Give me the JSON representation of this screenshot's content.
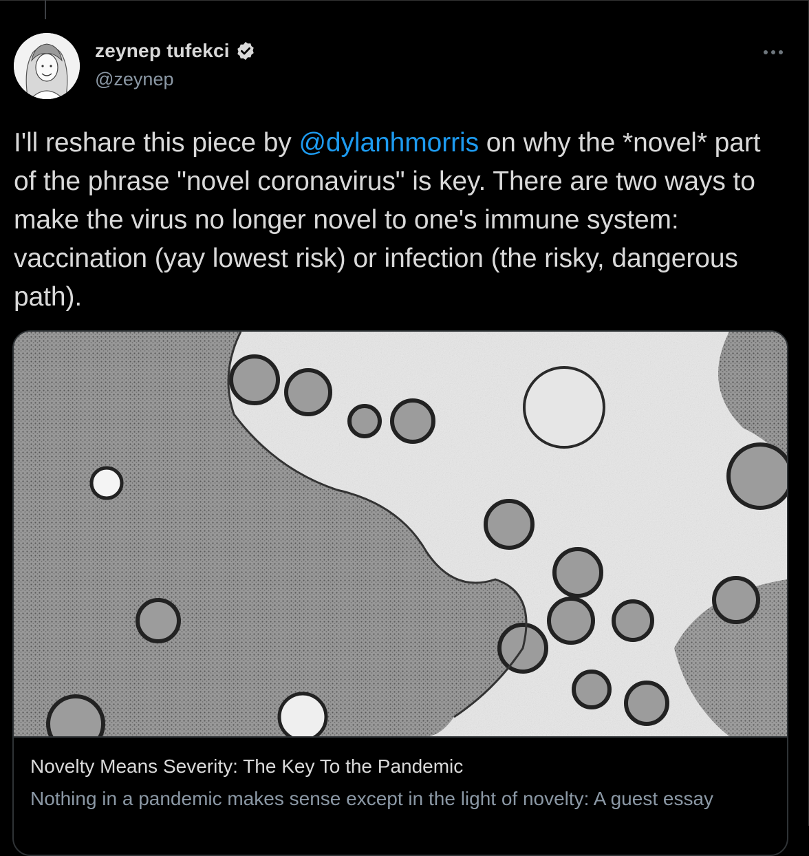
{
  "tweet": {
    "author": {
      "name": "zeynep tufekci",
      "handle": "@zeynep",
      "verified": true,
      "avatar_icon": "avatar-illustration"
    },
    "text_before_mention": "I'll reshare this piece by ",
    "mention": "@dylanhmorris",
    "text_after_mention": " on why the *novel* part of the phrase \"novel coronavirus\" is key. There are two ways to make the virus no longer novel to one's immune system: vaccination (yay lowest risk) or infection (the risky, dangerous path).",
    "more_icon": "more-horizontal-icon"
  },
  "card": {
    "image_icon": "coronavirus-micrograph-image",
    "title": "Novelty Means Severity: The Key To the Pandemic",
    "description": "Nothing in a pandemic makes sense except in the light of novelty: A guest essay"
  },
  "colors": {
    "background": "#000000",
    "text": "#d9d9d9",
    "secondary_text": "#8b98a5",
    "link": "#1d9bf0",
    "border": "#2f3336"
  }
}
